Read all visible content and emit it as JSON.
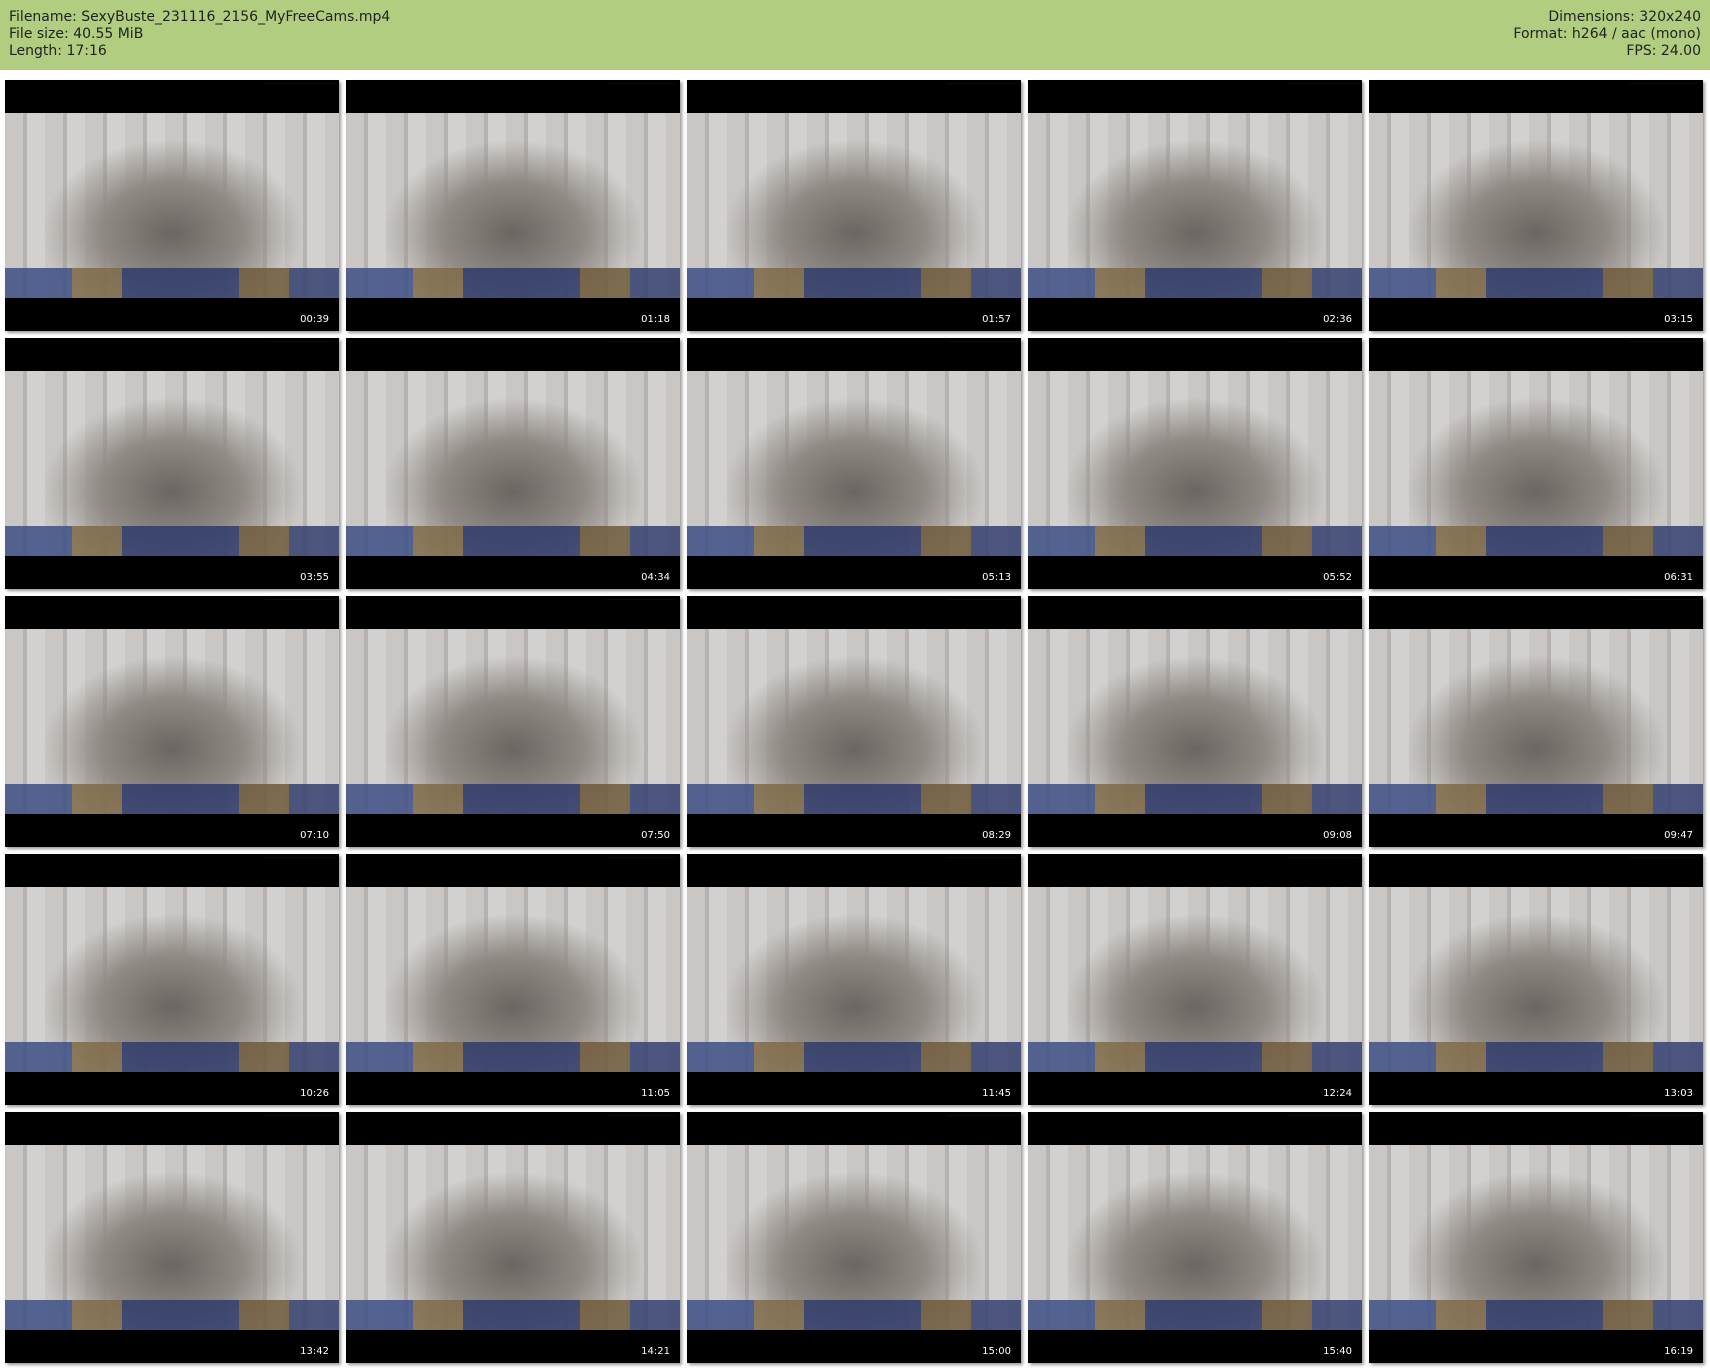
{
  "header": {
    "filename": "Filename: SexyBuste_231116_2156_MyFreeCams.mp4",
    "filesize": "File size: 40.55 MiB",
    "length": "Length: 17:16",
    "dimensions": "Dimensions: 320x240",
    "format": "Format: h264 / aac (mono)",
    "fps": "FPS: 24.00"
  },
  "thumbnails": [
    "00:39",
    "01:18",
    "01:57",
    "02:36",
    "03:15",
    "03:55",
    "04:34",
    "05:13",
    "05:52",
    "06:31",
    "07:10",
    "07:50",
    "08:29",
    "09:08",
    "09:47",
    "10:26",
    "11:05",
    "11:45",
    "12:24",
    "13:03",
    "13:42",
    "14:21",
    "15:00",
    "15:40",
    "16:19"
  ]
}
